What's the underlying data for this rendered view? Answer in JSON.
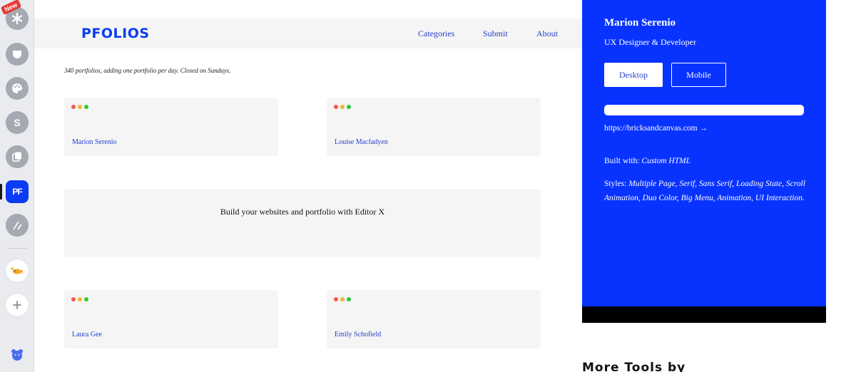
{
  "dock": {
    "new_badge": "New",
    "items": [
      {
        "icon": "asterisk-app-icon"
      },
      {
        "icon": "pocket-app-icon"
      },
      {
        "icon": "palette-app-icon"
      },
      {
        "icon": "s-app-icon"
      },
      {
        "icon": "layers-app-icon"
      },
      {
        "icon": "pfolios-app-icon",
        "label": "PF"
      },
      {
        "icon": "slash-app-icon"
      },
      {
        "icon": "fish-app-icon"
      },
      {
        "icon": "add-icon"
      },
      {
        "icon": "bear-icon"
      }
    ],
    "accent": "#0b3cf5"
  },
  "header": {
    "brand": "PFOLIOS",
    "nav": [
      "Categories",
      "Submit",
      "About"
    ]
  },
  "tagline": "340 portfolios, adding one portfolio per day. Closed on Sundays.",
  "cards": [
    {
      "name": "Marion Serenio"
    },
    {
      "name": "Louise Macfadyen"
    },
    {
      "name": "Laura Gee"
    },
    {
      "name": "Emily Schofield"
    }
  ],
  "promo": "Build your websites and portfolio with Editor X",
  "panel": {
    "name": "Marion Serenio",
    "role": "UX Designer & Developer",
    "desktop_label": "Desktop",
    "mobile_label": "Mobile",
    "url": "https://bricksandcanvas.com →",
    "built_label": "Built with:",
    "built_value": "Custom HTML",
    "styles_label": "Styles:",
    "styles_value": "Multiple Page, Serif, Sans Serif, Loading State, Scroll Animation, Duo Color, Big Menu, Animation, UI Interaction.",
    "background": "#0833ff"
  },
  "more_tools": "More Tools by"
}
